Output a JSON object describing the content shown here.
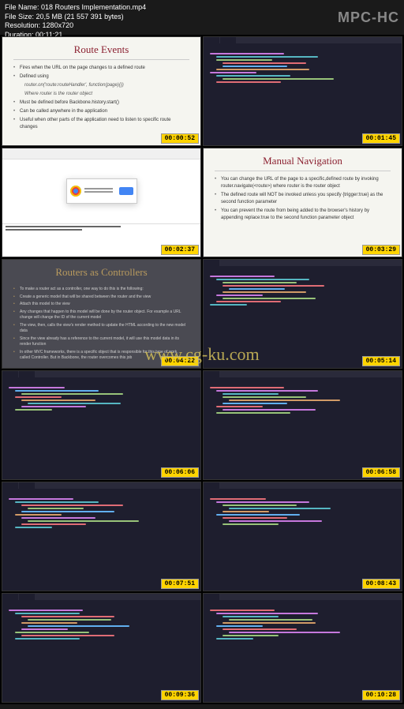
{
  "header": {
    "filename_label": "File Name:",
    "filename": "018 Routers Implementation.mp4",
    "filesize_label": "File Size:",
    "filesize": "20,5 MB (21 557 391 bytes)",
    "resolution_label": "Resolution:",
    "resolution": "1280x720",
    "duration_label": "Duration:",
    "duration": "00:11:21",
    "logo": "MPC-HC"
  },
  "watermark": "www.cg-ku.com",
  "thumbs": [
    {
      "type": "slide",
      "title": "Route Events",
      "bullets": [
        {
          "t": "Fires when the URL on the page changes to a defined route"
        },
        {
          "t": "Defined using"
        },
        {
          "t": "router.on('route:routeHandler', function(page){})",
          "sub": true
        },
        {
          "t": "Where router is the router object",
          "sub": true
        },
        {
          "t": "Must be defined before Backbone.history.start()"
        },
        {
          "t": "Can be called anywhere in the application"
        },
        {
          "t": "Useful when other parts of the application need to listen to specific route changes"
        }
      ],
      "ts": "00:00:52"
    },
    {
      "type": "code",
      "ts": "00:01:45"
    },
    {
      "type": "browser",
      "ts": "00:02:37"
    },
    {
      "type": "slide",
      "title": "Manual Navigation",
      "bullets": [
        {
          "t": "You can change the URL of the page to a specific,defined route by invoking router.navigate(<route>) where router is the router object"
        },
        {
          "t": "The defined route will NOT be invoked unless you specify {trigger:true} as the second function parameter"
        },
        {
          "t": "You can prevent the route from being added to the browser's history by appending replace:true to the second function parameter object"
        }
      ],
      "ts": "00:03:29"
    },
    {
      "type": "slide-dark",
      "title": "Routers as Controllers",
      "bullets": [
        {
          "t": "To make a router act as a controller, one way to do this is the following:"
        },
        {
          "t": "Create a generic model that will be shared between the router and the view"
        },
        {
          "t": "Attach this model to the view"
        },
        {
          "t": "Any changes that happen to this model will be done by the router object. For example a URL change will change the ID of the current model"
        },
        {
          "t": "The view, then, calls the view's render method to update the HTML according to the new model data"
        },
        {
          "t": "Since the view already has a reference to the current model, it will use this model data in its render function"
        },
        {
          "t": "In other MVC frameworks, there is a specific object that is responsible for this type of work, called Controller. But in Backbone, the router overcomes this job"
        }
      ],
      "ts": "00:04:22"
    },
    {
      "type": "code",
      "ts": "00:05:14"
    },
    {
      "type": "code",
      "ts": "00:06:06"
    },
    {
      "type": "code",
      "ts": "00:06:58"
    },
    {
      "type": "code",
      "ts": "00:07:51"
    },
    {
      "type": "code",
      "ts": "00:08:43"
    },
    {
      "type": "code",
      "ts": "00:09:36"
    },
    {
      "type": "code",
      "ts": "00:10:28"
    }
  ]
}
